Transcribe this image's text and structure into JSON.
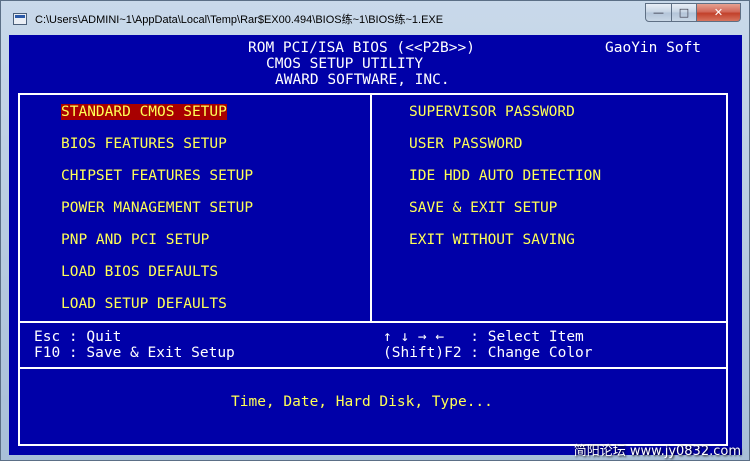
{
  "window": {
    "title": "C:\\Users\\ADMINI~1\\AppData\\Local\\Temp\\Rar$EX00.494\\BIOS练~1\\BIOS练~1.EXE",
    "minimize_glyph": "—",
    "maximize_glyph": "□",
    "close_glyph": "✕"
  },
  "bios_header": {
    "line1": "ROM PCI/ISA BIOS (<<P2B>>)",
    "line2": "CMOS SETUP UTILITY",
    "line3": "AWARD SOFTWARE, INC.",
    "brand": "GaoYin Soft"
  },
  "menu": {
    "left": [
      {
        "label": "STANDARD CMOS SETUP",
        "selected": true
      },
      {
        "label": "BIOS FEATURES SETUP",
        "selected": false
      },
      {
        "label": "CHIPSET FEATURES SETUP",
        "selected": false
      },
      {
        "label": "POWER MANAGEMENT SETUP",
        "selected": false
      },
      {
        "label": "PNP AND PCI SETUP",
        "selected": false
      },
      {
        "label": "LOAD BIOS DEFAULTS",
        "selected": false
      },
      {
        "label": "LOAD SETUP DEFAULTS",
        "selected": false
      }
    ],
    "right": [
      {
        "label": "SUPERVISOR PASSWORD"
      },
      {
        "label": "USER PASSWORD"
      },
      {
        "label": "IDE HDD AUTO DETECTION"
      },
      {
        "label": "SAVE & EXIT SETUP"
      },
      {
        "label": "EXIT WITHOUT SAVING"
      }
    ]
  },
  "keys": {
    "esc": "Esc : Quit",
    "f10": "F10 : Save & Exit Setup",
    "arrows": "↑ ↓ → ←   : Select Item",
    "shift_f2": "(Shift)F2 : Change Color"
  },
  "hint": "Time, Date, Hard Disk, Type...",
  "watermark": "简阳论坛 www.jy0832.com",
  "colors": {
    "bios_background": "#0000a8",
    "menu_text": "#ffff55",
    "selection_bar": "#a80000",
    "frame": "#ffffff"
  }
}
